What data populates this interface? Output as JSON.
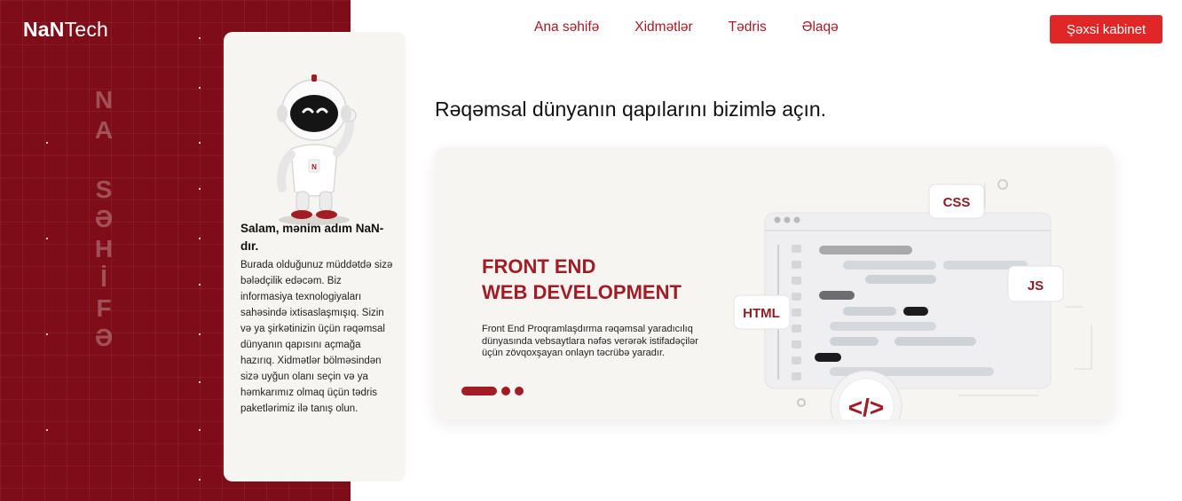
{
  "brand": {
    "bold": "NaN",
    "thin": "Tech"
  },
  "side_vertical_text": [
    "N",
    "A",
    " ",
    "S",
    "Ə",
    "H",
    "İ",
    "F",
    "Ə"
  ],
  "nav": {
    "items": [
      "Ana səhifə",
      "Xidmətlər",
      "Tədris",
      "Əlaqə"
    ],
    "cabinet_button": "Şəxsi kabinet"
  },
  "card": {
    "title": "Salam, mənim adım NaN-dır.",
    "body": "Burada olduğunuz müddətdə sizə bələdçilik edəcəm. Biz informasiya texnologiyaları sahəsində ixtisaslaşmışıq. Sizin və ya şirkətinizin üçün rəqəmsal dünyanın qapısını açmağa hazırıq. Xidmətlər bölməsindən sizə uyğun olanı seçin və ya həmkarımız olmaq üçün tədris paketlərimiz ilə tanış olun."
  },
  "headline": "Rəqəmsal dünyanın qapılarını bizimlə açın.",
  "banner": {
    "title_line1": "FRONT END",
    "title_line2": "WEB DEVELOPMENT",
    "description": "Front End Proqramlaşdırma rəqəmsal yaradıcılıq dünyasında vebsaytlara nəfəs verərək istifadəçilər üçün zövqoxşayan onlayn təcrübə yaradır.",
    "tags": {
      "css": "CSS",
      "js": "JS",
      "html": "HTML",
      "code": "</>"
    }
  },
  "colors": {
    "brand_red": "#a31b24",
    "side_bg": "#7e0d17",
    "button_red": "#e02626"
  }
}
